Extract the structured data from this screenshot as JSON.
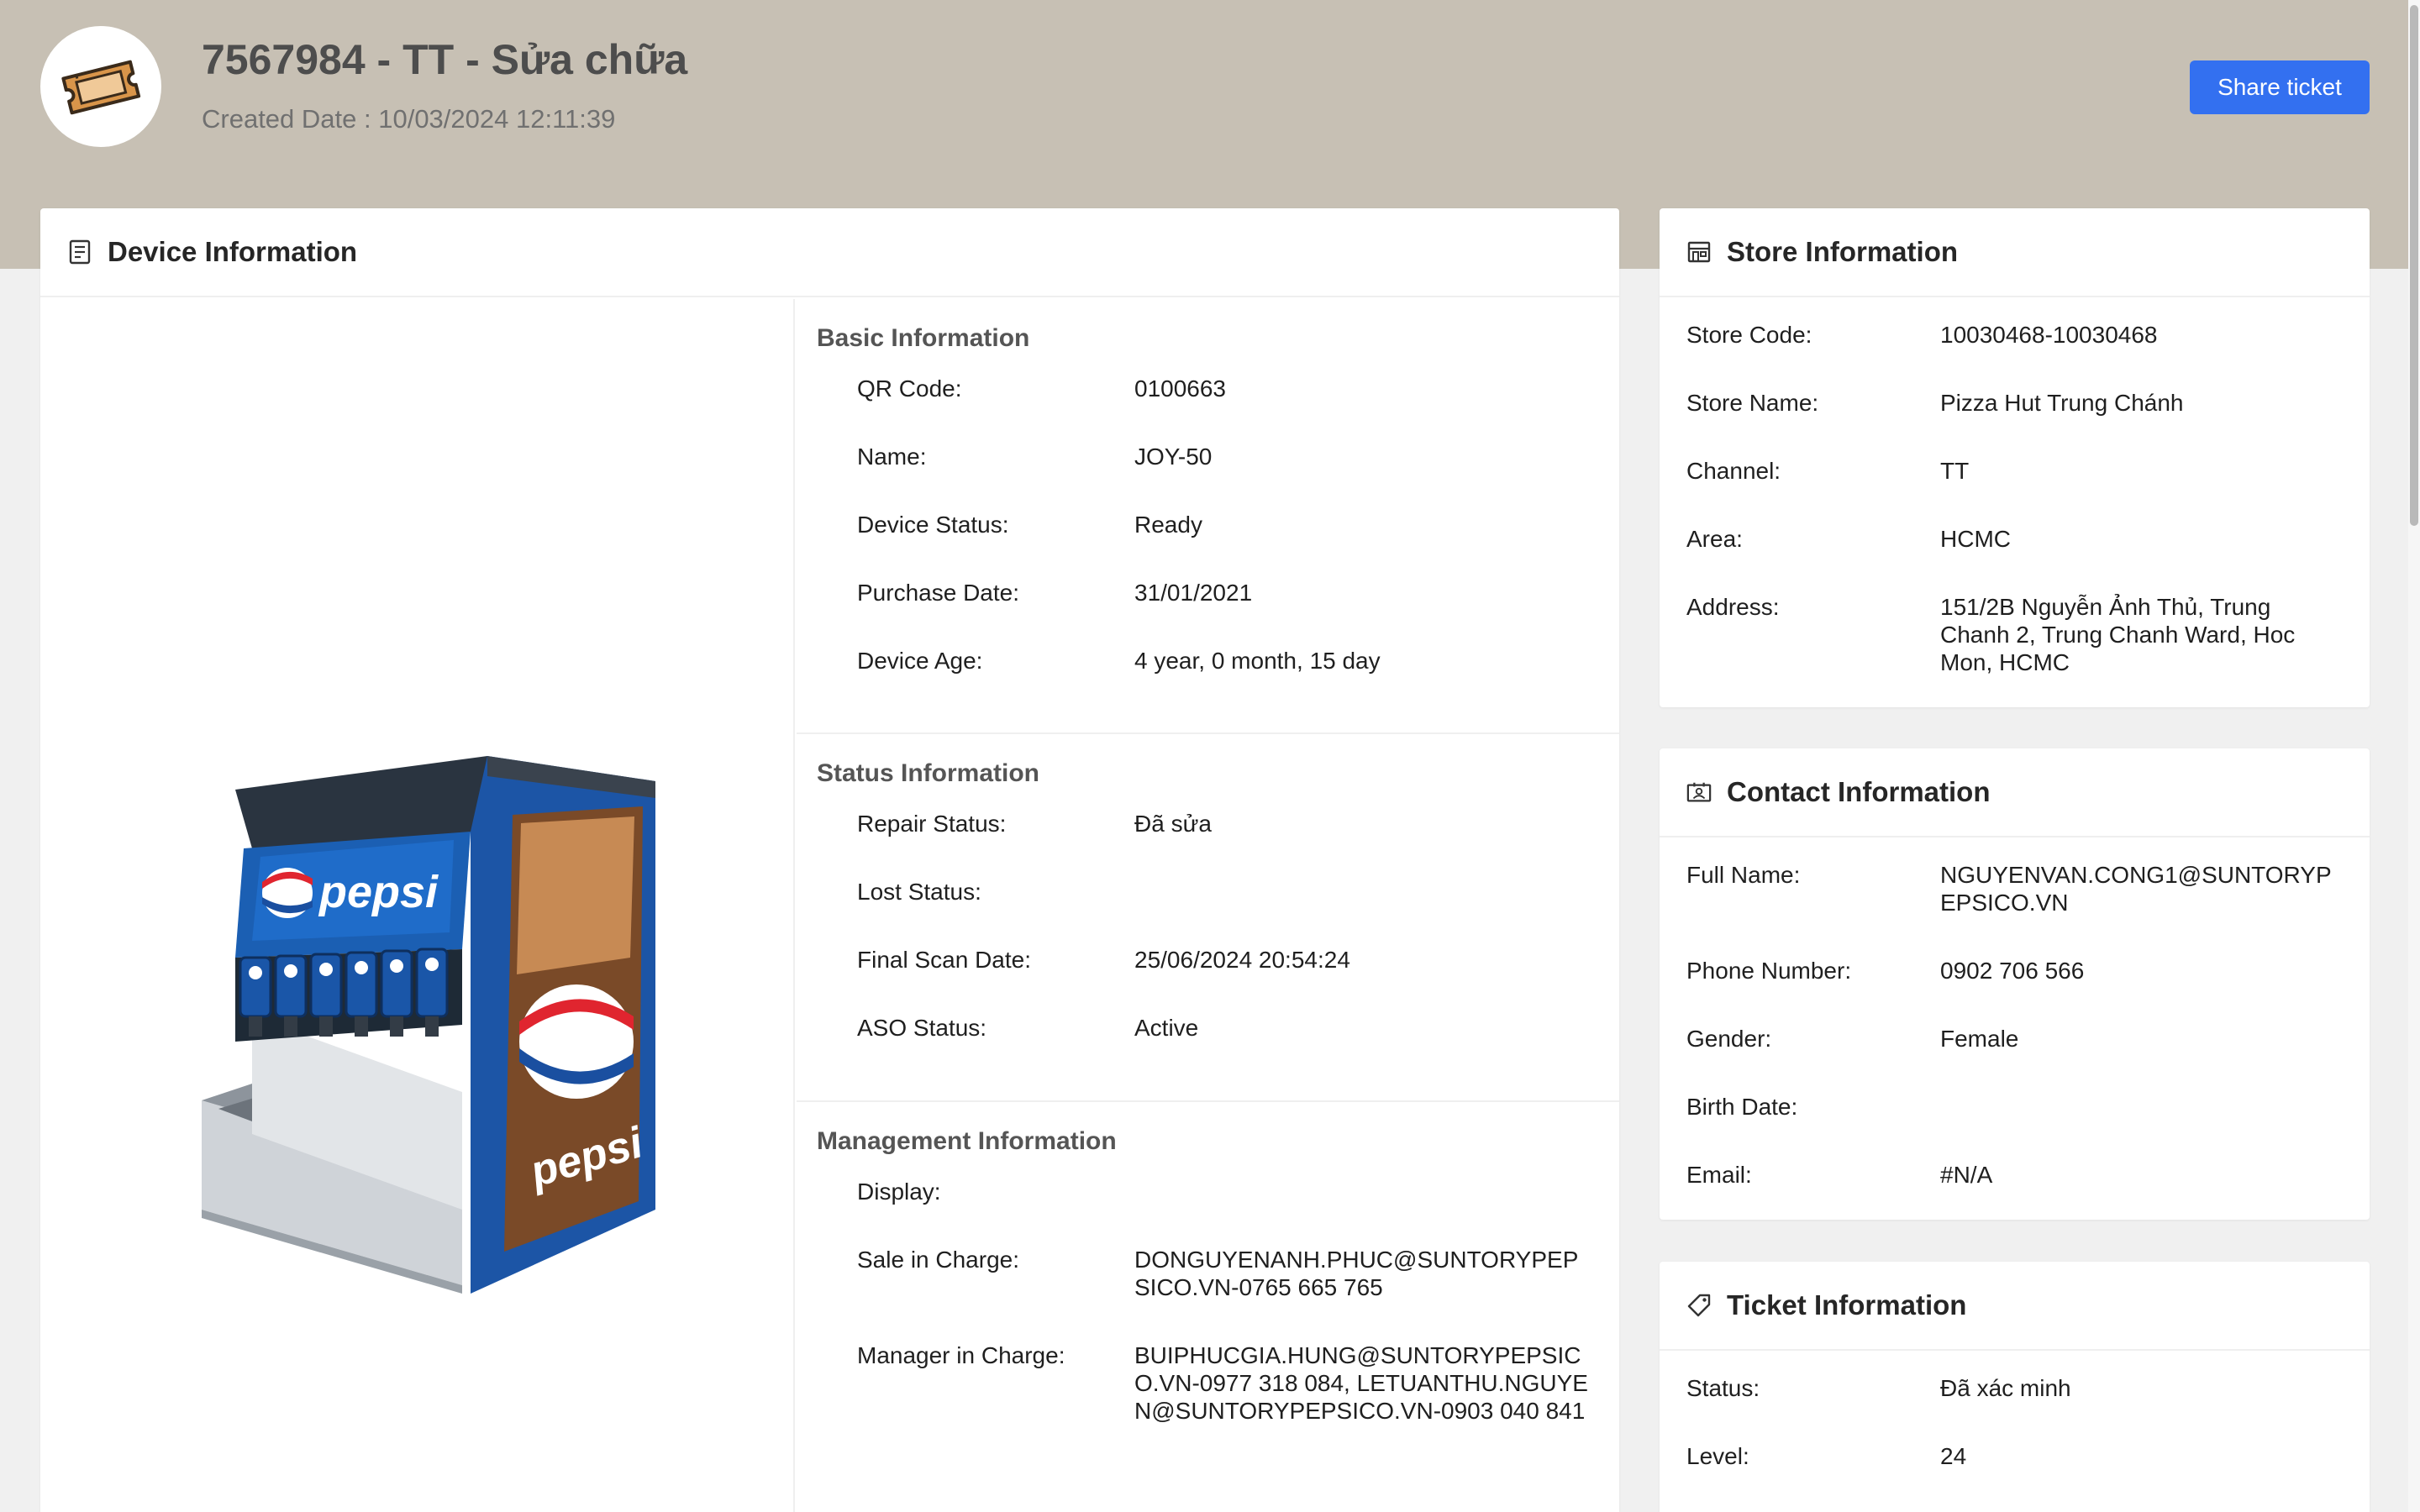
{
  "header": {
    "title": "7567984 - TT - Sửa chữa",
    "created_date": "Created Date : 10/03/2024 12:11:39",
    "share_button": "Share ticket",
    "avatar_icon": "ticket-icon",
    "accent_color": "#3370f0",
    "band_color": "#c7c0b4"
  },
  "device": {
    "title": "Device Information",
    "icon": "document-icon",
    "image": "pepsi-fountain-dispenser",
    "basic": {
      "title": "Basic Information",
      "rows": [
        {
          "label": "QR Code:",
          "value": "0100663"
        },
        {
          "label": "Name:",
          "value": "JOY-50"
        },
        {
          "label": "Device Status:",
          "value": "Ready"
        },
        {
          "label": "Purchase Date:",
          "value": "31/01/2021"
        },
        {
          "label": "Device Age:",
          "value": "4 year, 0 month, 15 day"
        }
      ]
    },
    "status": {
      "title": "Status Information",
      "rows": [
        {
          "label": "Repair Status:",
          "value": "Đã sửa"
        },
        {
          "label": "Lost Status:",
          "value": ""
        },
        {
          "label": "Final Scan Date:",
          "value": "25/06/2024 20:54:24"
        },
        {
          "label": "ASO Status:",
          "value": "Active"
        }
      ]
    },
    "management": {
      "title": "Management Information",
      "rows": [
        {
          "label": "Display:",
          "value": ""
        },
        {
          "label": "Sale in Charge:",
          "value": "DONGUYENANH.PHUC@SUNTORYPEPSICO.VN-0765 665 765"
        },
        {
          "label": "Manager in Charge:",
          "value": "BUIPHUCGIA.HUNG@SUNTORYPEPSICO.VN-0977 318 084, LETUANTHU.NGUYEN@SUNTORYPEPSICO.VN-0903 040 841"
        }
      ]
    }
  },
  "store": {
    "title": "Store Information",
    "icon": "store-icon",
    "rows": [
      {
        "label": "Store Code:",
        "value": "10030468-10030468"
      },
      {
        "label": "Store Name:",
        "value": "Pizza Hut Trung Chánh"
      },
      {
        "label": "Channel:",
        "value": "TT"
      },
      {
        "label": "Area:",
        "value": "HCMC"
      },
      {
        "label": "Address:",
        "value": "151/2B Nguyễn Ảnh Thủ, Trung Chanh 2, Trung Chanh Ward, Hoc Mon, HCMC"
      }
    ]
  },
  "contact": {
    "title": "Contact Information",
    "icon": "contact-card-icon",
    "rows": [
      {
        "label": "Full Name:",
        "value": "NGUYENVAN.CONG1@SUNTORYPEPSICO.VN"
      },
      {
        "label": "Phone Number:",
        "value": "0902 706 566"
      },
      {
        "label": "Gender:",
        "value": "Female"
      },
      {
        "label": "Birth Date:",
        "value": ""
      },
      {
        "label": "Email:",
        "value": "#N/A"
      }
    ]
  },
  "ticket": {
    "title": "Ticket Information",
    "icon": "tag-icon",
    "rows": [
      {
        "label": "Status:",
        "value": "Đã xác minh"
      },
      {
        "label": "Level:",
        "value": "24"
      }
    ]
  }
}
